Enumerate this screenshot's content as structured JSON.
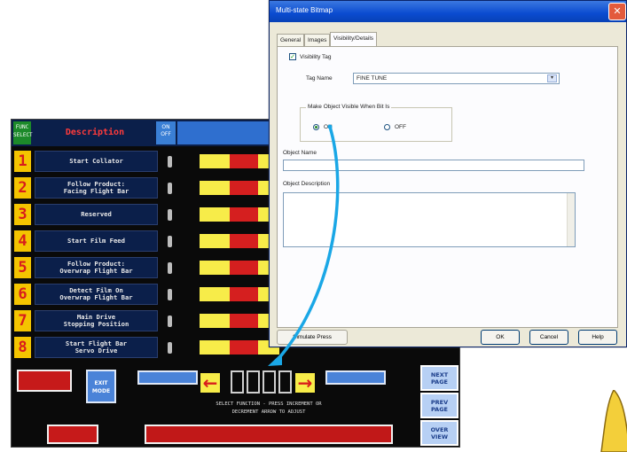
{
  "hmi": {
    "header": {
      "num_label": "FUNC\nSELECT",
      "description_label": "Description",
      "onoff_label": "ON\nOFF"
    },
    "rows": [
      {
        "num": "1",
        "desc": "Start Collator"
      },
      {
        "num": "2",
        "desc": "Follow Product:\nFacing Flight Bar"
      },
      {
        "num": "3",
        "desc": "Reserved"
      },
      {
        "num": "4",
        "desc": "Start Film Feed"
      },
      {
        "num": "5",
        "desc": "Follow Product:\nOverwrap Flight Bar"
      },
      {
        "num": "6",
        "desc": "Detect Film On\nOverwrap Flight Bar"
      },
      {
        "num": "7",
        "desc": "Main Drive\nStopping Position"
      },
      {
        "num": "8",
        "desc": "Start Flight Bar\nServo Drive"
      }
    ],
    "bottom": {
      "exit_mode": "EXIT\nMODE",
      "instruction": "SELECT FUNCTION - PRESS INCREMENT OR\nDECREMENT ARROW TO ADJUST",
      "next_page": "NEXT\nPAGE",
      "prev_page": "PREV\nPAGE",
      "overview": "OVER\nVIEW"
    },
    "colors": {
      "yellow": "#f7ec49",
      "red": "#d51f1f",
      "navy": "#0b1f4a",
      "num_bg": "#f4c400"
    }
  },
  "dialog": {
    "title": "Multi-state Bitmap",
    "close_icon": "close-icon",
    "tabs": [
      "General",
      "Images",
      "Visibility/Details"
    ],
    "active_tab": "Visibility/Details",
    "visibility_tag_label": "Visibility Tag",
    "tag_name_label": "Tag Name",
    "tag_name_value": "FINE TUNE",
    "group_label": "Make Object Visible When Bit Is",
    "radio_on": "ON",
    "radio_off": "OFF",
    "object_name_label": "Object Name",
    "object_description_label": "Object Description",
    "simulate_label": "Simulate Press",
    "ok_label": "OK",
    "cancel_label": "Cancel",
    "help_label": "Help",
    "accent_color": "#0a4bd0"
  },
  "callout": {
    "color": "#1aa7e6"
  }
}
